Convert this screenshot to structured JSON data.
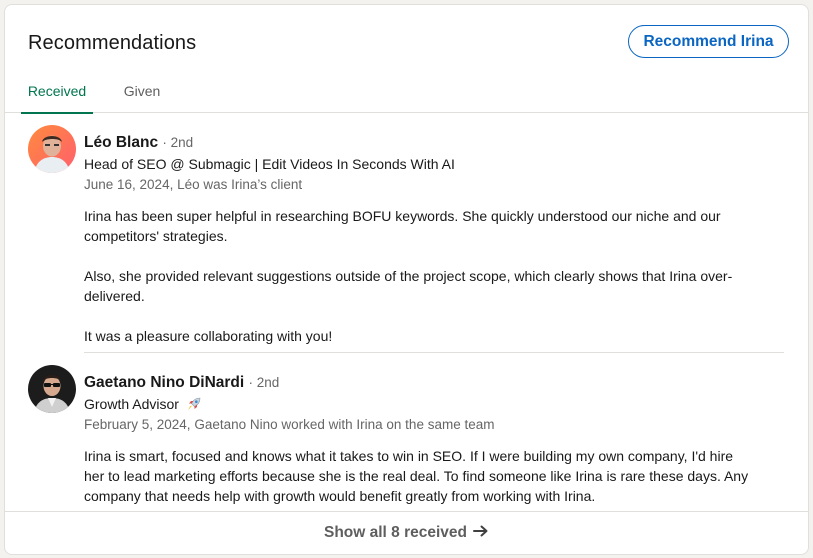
{
  "section": {
    "title": "Recommendations",
    "recommend_button": "Recommend Irina"
  },
  "tabs": [
    {
      "label": "Received",
      "active": true
    },
    {
      "label": "Given",
      "active": false
    }
  ],
  "recommendations": [
    {
      "name": "Léo Blanc",
      "degree": "· 2nd",
      "headline": "Head of SEO @ Submagic | Edit Videos In Seconds With AI",
      "meta": "June 16, 2024, Léo was Irina’s client",
      "paragraphs": [
        "Irina has been super helpful in researching BOFU keywords. She quickly understood our niche and our competitors' strategies.",
        "Also, she provided relevant suggestions outside of the project scope, which clearly shows that Irina over-delivered.",
        "It was a pleasure collaborating with you!"
      ]
    },
    {
      "name": "Gaetano Nino DiNardi",
      "degree": "· 2nd",
      "headline": "Growth Advisor",
      "headline_icon": "rocket-icon",
      "meta": "February 5, 2024, Gaetano Nino worked with Irina on the same team",
      "paragraphs": [
        "Irina is smart, focused and knows what it takes to win in SEO. If I were building my own company, I'd hire her to lead marketing efforts because she is the real deal. To find someone like Irina is rare these days. Any company that needs help with growth would benefit greatly from working with Irina."
      ]
    }
  ],
  "footer": {
    "show_all": "Show all 8 received",
    "arrow_icon": "arrow-right-icon"
  },
  "colors": {
    "accent_blue": "#0a66c2",
    "active_tab_green": "#01754f"
  }
}
